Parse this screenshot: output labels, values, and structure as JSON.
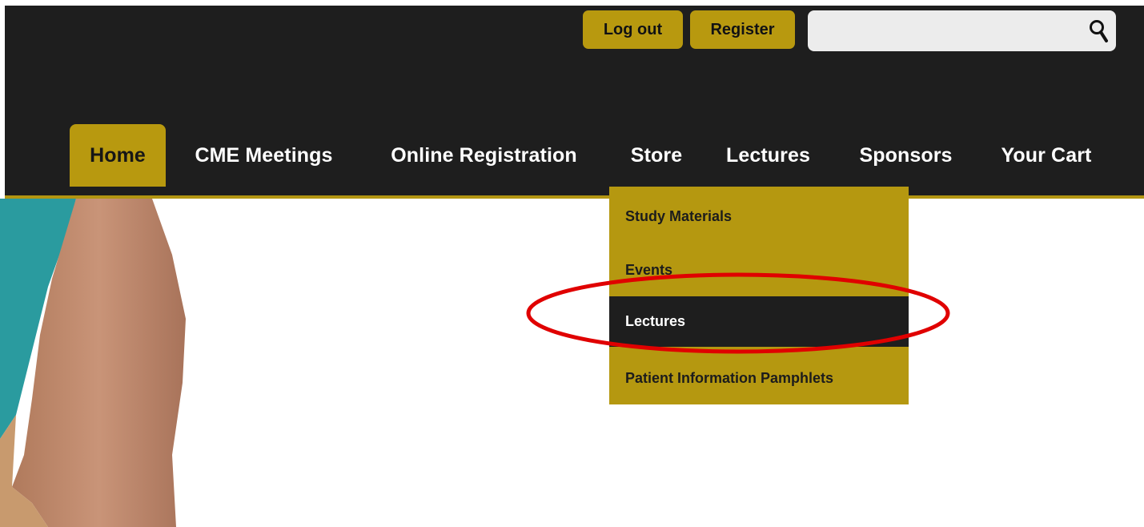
{
  "header": {
    "logout_label": "Log out",
    "register_label": "Register",
    "search": {
      "value": "",
      "placeholder": ""
    }
  },
  "nav": {
    "items": [
      {
        "label": "Home",
        "active": true
      },
      {
        "label": "CME Meetings"
      },
      {
        "label": "Online Registration"
      },
      {
        "label": "Store"
      },
      {
        "label": "Lectures"
      },
      {
        "label": "Sponsors"
      },
      {
        "label": "Your Cart"
      }
    ]
  },
  "dropdown": {
    "parent": "Store",
    "items": [
      {
        "label": "Study Materials"
      },
      {
        "label": "Events"
      },
      {
        "label": "Lectures",
        "highlighted": true
      },
      {
        "label": "Patient Information Pamphlets"
      }
    ]
  },
  "colors": {
    "header_bg": "#1e1e1e",
    "accent_gold": "#b8990f",
    "annotation_red": "#e00000"
  },
  "icons": [
    "search-icon"
  ]
}
